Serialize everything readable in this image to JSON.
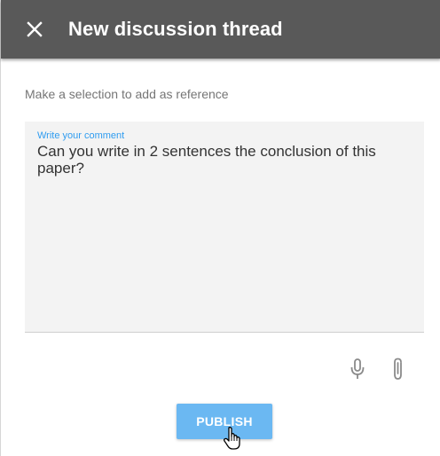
{
  "header": {
    "title": "New discussion thread",
    "close_icon": "close-icon",
    "background": "#595959"
  },
  "reference_hint": "Make a selection to add as reference",
  "comment": {
    "label": "Write your comment",
    "value": "Can you write in 2 sentences the conclusion of this paper?",
    "label_color": "#2f9cf0"
  },
  "tools": {
    "mic_icon": "microphone-icon",
    "attach_icon": "paperclip-icon"
  },
  "publish": {
    "label": "PUBLISH",
    "color": "#6bb8f2"
  },
  "cursor_icon": "hand-pointer-icon"
}
